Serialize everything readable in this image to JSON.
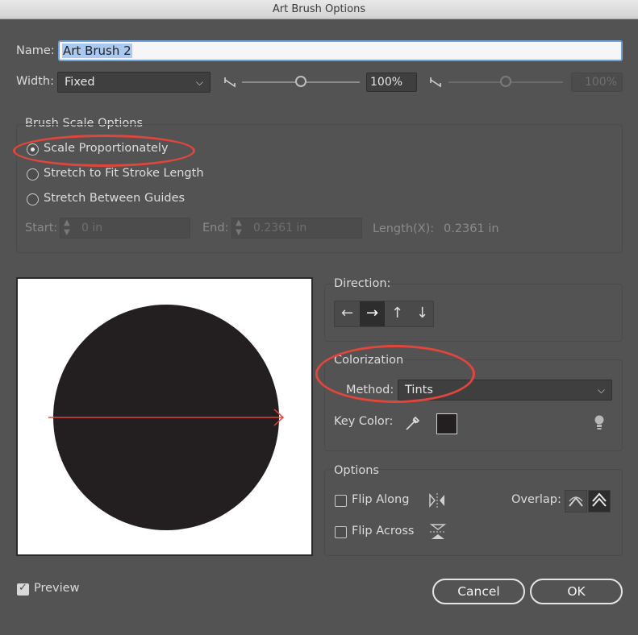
{
  "window": {
    "title": "Art Brush Options"
  },
  "name": {
    "label": "Name:",
    "value": "Art Brush 2"
  },
  "width": {
    "label": "Width:",
    "selected": "Fixed",
    "slider_value": 0.5,
    "value": "100%",
    "max_value": "100%"
  },
  "brush_scale": {
    "title": "Brush Scale Options",
    "options": [
      {
        "label": "Scale Proportionately",
        "selected": true
      },
      {
        "label": "Stretch to Fit Stroke Length",
        "selected": false
      },
      {
        "label": "Stretch Between Guides",
        "selected": false
      }
    ],
    "start_label": "Start:",
    "start_value": "0 in",
    "end_label": "End:",
    "end_value": "0.2361 in",
    "length_label": "Length(X):",
    "length_value": "0.2361 in"
  },
  "direction": {
    "title": "Direction:",
    "buttons": [
      "←",
      "→",
      "↑",
      "↓"
    ],
    "active_index": 1
  },
  "colorization": {
    "title": "Colorization",
    "method_label": "Method:",
    "method_value": "Tints",
    "key_color_label": "Key Color:",
    "key_color": "#231f20"
  },
  "options": {
    "title": "Options",
    "flip_along": "Flip Along",
    "flip_across": "Flip Across",
    "overlap_label": "Overlap:"
  },
  "footer": {
    "preview_label": "Preview",
    "preview_checked": true,
    "cancel_label": "Cancel",
    "ok_label": "OK"
  },
  "colors": {
    "dialog_bg": "#535353",
    "annotation_red": "#e0463c",
    "shape_fill": "#231f20"
  }
}
